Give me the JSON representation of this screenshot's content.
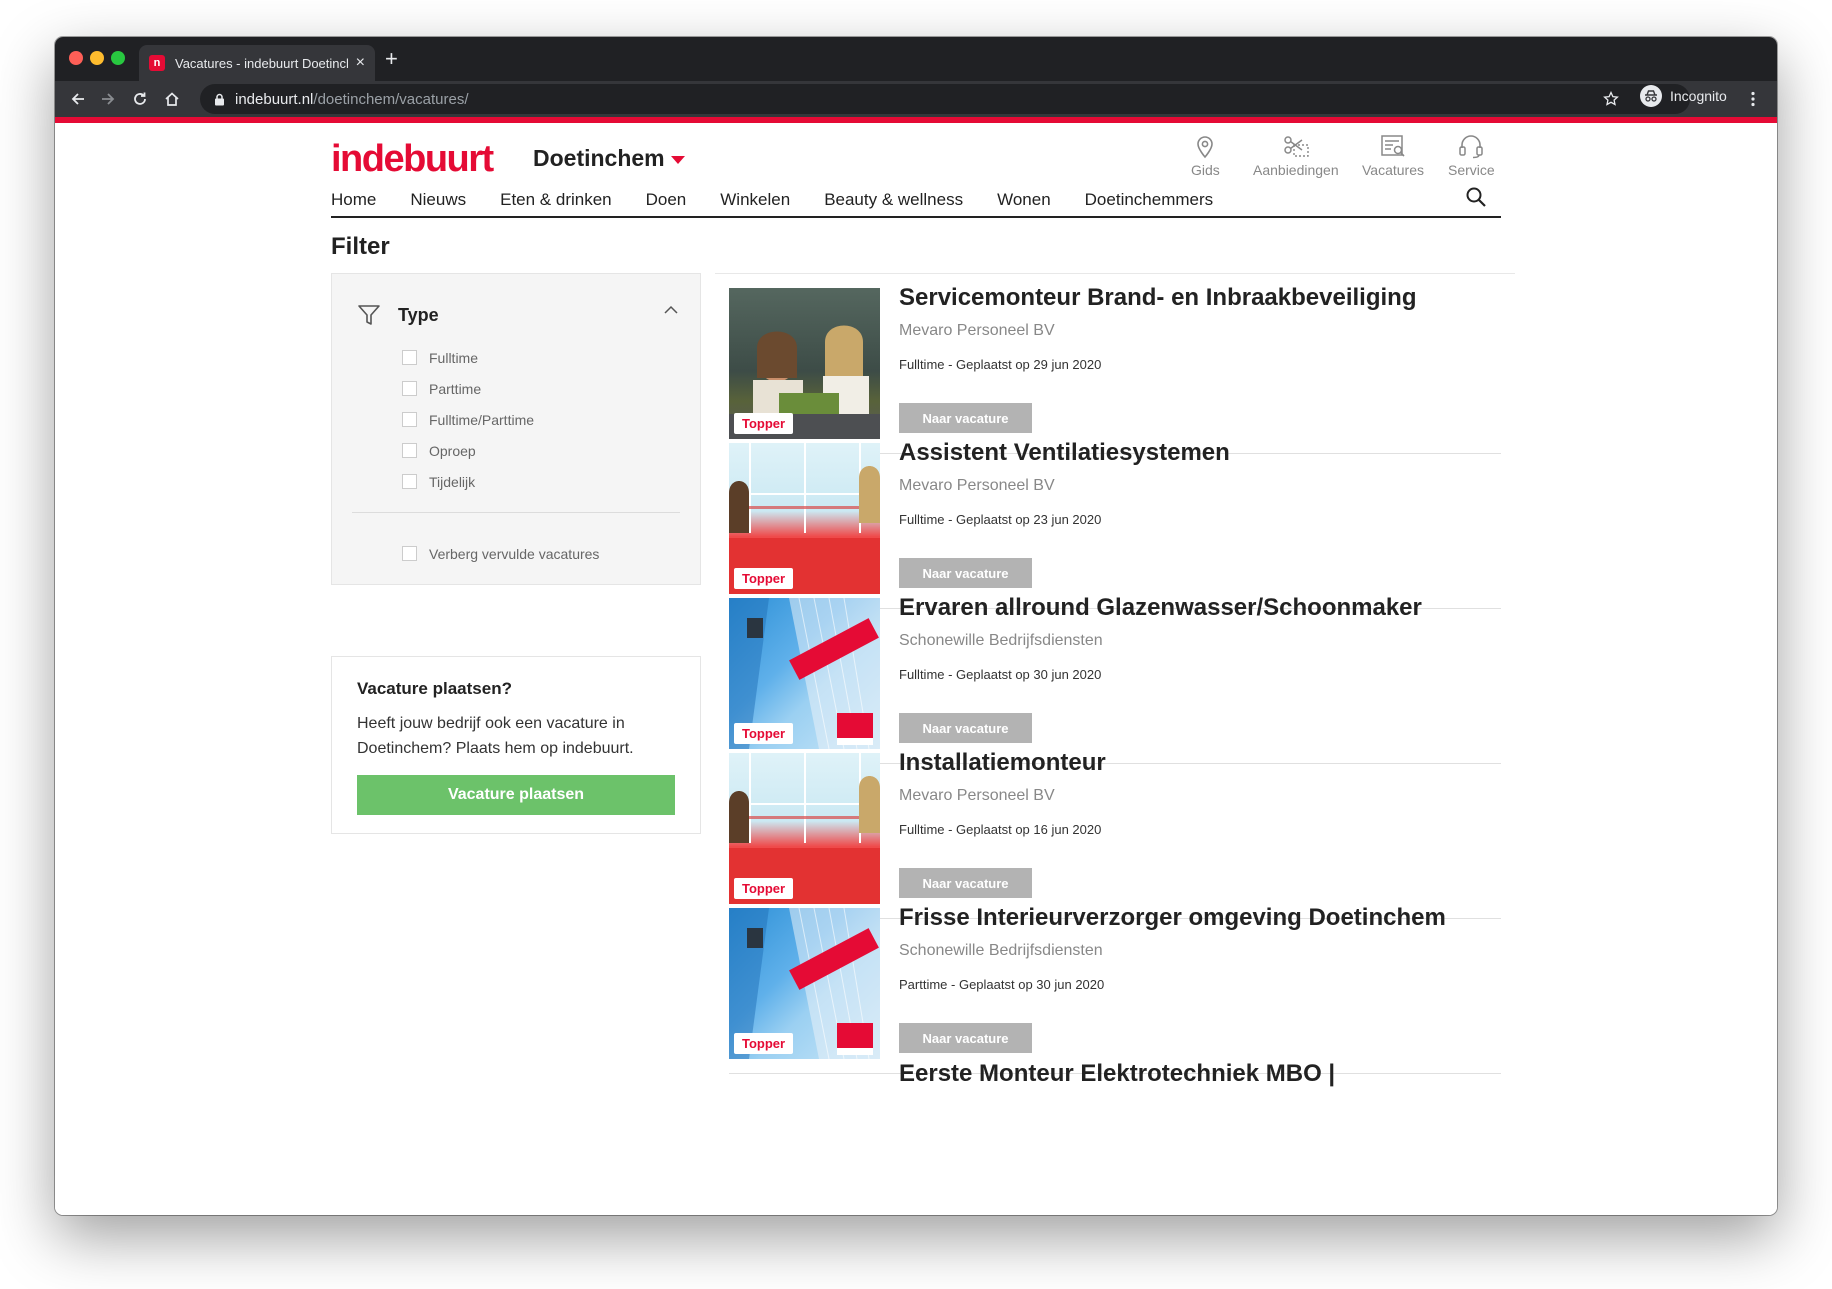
{
  "browser": {
    "tab_title": "Vacatures - indebuurt Doetinchem",
    "tab_favicon": "n",
    "new_tab": "+",
    "tab_close": "×",
    "url_host": "indebuurt.nl",
    "url_path": "/doetinchem/vacatures/",
    "incognito_label": "Incognito"
  },
  "header": {
    "logo": "indebuurt",
    "city": "Doetinchem",
    "utility": [
      {
        "label": "Gids",
        "icon": "map-pin-icon"
      },
      {
        "label": "Aanbiedingen",
        "icon": "scissors-coupon-icon"
      },
      {
        "label": "Vacatures",
        "icon": "newspaper-search-icon"
      },
      {
        "label": "Service",
        "icon": "headset-icon"
      }
    ],
    "nav": [
      "Home",
      "Nieuws",
      "Eten & drinken",
      "Doen",
      "Winkelen",
      "Beauty & wellness",
      "Wonen",
      "Doetinchemmers"
    ]
  },
  "filter": {
    "title": "Filter",
    "section_label": "Type",
    "options": [
      "Fulltime",
      "Parttime",
      "Fulltime/Parttime",
      "Oproep",
      "Tijdelijk"
    ],
    "hide_filled": "Verberg vervulde vacatures"
  },
  "post_box": {
    "title": "Vacature plaatsen?",
    "text": "Heeft jouw bedrijf ook een vacature in Doetinchem? Plaats hem op indebuurt.",
    "button": "Vacature plaatsen"
  },
  "jobs": [
    {
      "title": "Servicemonteur Brand- en Inbraakbeveiliging",
      "company": "Mevaro Personeel BV",
      "meta": "Fulltime - Geplaatst op 29 jun 2020",
      "badge": "Topper",
      "button": "Naar vacature"
    },
    {
      "title": "Assistent Ventilatiesystemen",
      "company": "Mevaro Personeel BV",
      "meta": "Fulltime - Geplaatst op 23 jun 2020",
      "badge": "Topper",
      "button": "Naar vacature"
    },
    {
      "title": "Ervaren allround Glazenwasser/Schoonmaker",
      "company": "Schonewille Bedrijfsdiensten",
      "meta": "Fulltime - Geplaatst op 30 jun 2020",
      "badge": "Topper",
      "button": "Naar vacature"
    },
    {
      "title": "Installatiemonteur",
      "company": "Mevaro Personeel BV",
      "meta": "Fulltime - Geplaatst op 16 jun 2020",
      "badge": "Topper",
      "button": "Naar vacature"
    },
    {
      "title": "Frisse Interieurverzorger omgeving Doetinchem",
      "company": "Schonewille Bedrijfsdiensten",
      "meta": "Parttime - Geplaatst op 30 jun 2020",
      "badge": "Topper",
      "button": "Naar vacature"
    },
    {
      "title": "Eerste Monteur Elektrotechniek MBO |",
      "company": "",
      "meta": "",
      "badge": "",
      "button": ""
    }
  ],
  "colors": {
    "brand_red": "#e50b35",
    "post_button_green": "#6cc26a",
    "job_button_gray": "#b3b3b3"
  }
}
